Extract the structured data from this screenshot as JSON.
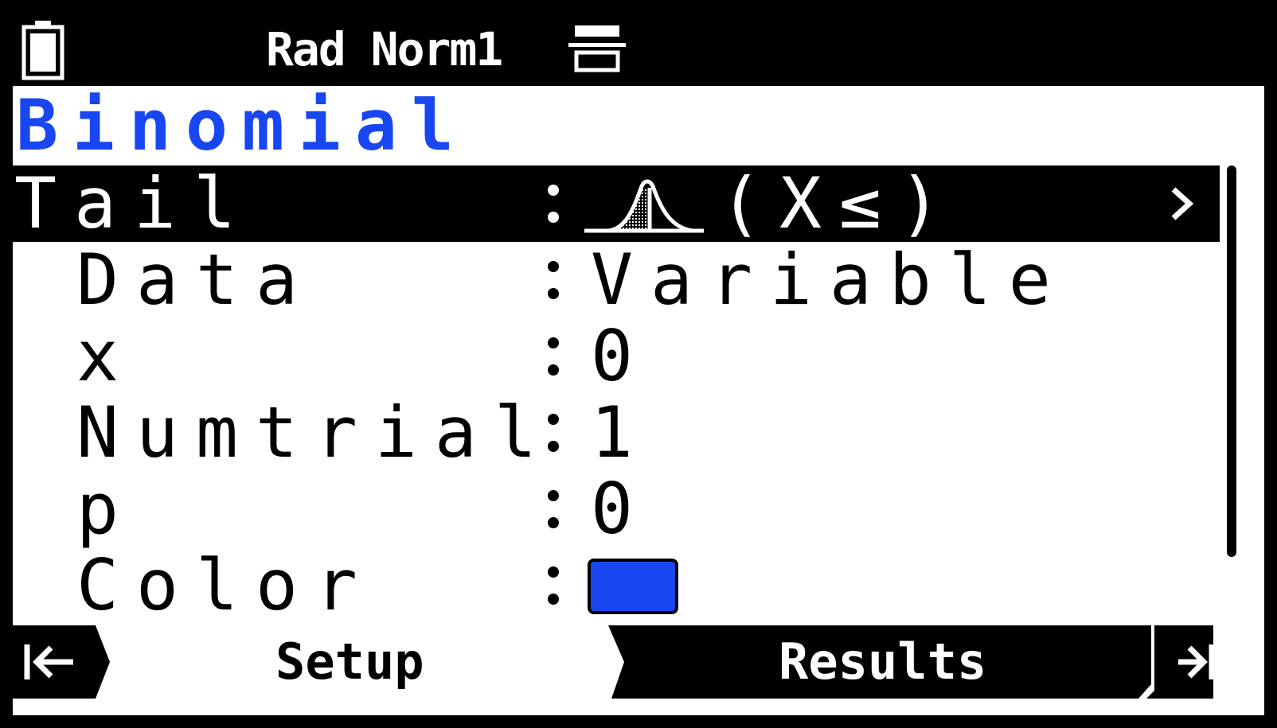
{
  "status_bar": {
    "mode": "Rad Norm1",
    "battery_icon": "battery-icon",
    "sheet_icon": "sheet-icon"
  },
  "app_title": "Binomial",
  "settings": [
    {
      "label": "Tail",
      "value": "(X≤)",
      "selected": true
    },
    {
      "label": "Data",
      "value": "Variable"
    },
    {
      "label": "x",
      "value": "0"
    },
    {
      "label": "Numtrial",
      "value": "1"
    },
    {
      "label": "p",
      "value": "0"
    },
    {
      "label": "Color",
      "value_color": "#1846f0"
    }
  ],
  "tabs": [
    {
      "label": "Setup",
      "active": true
    },
    {
      "label": "Results",
      "active": false
    }
  ],
  "colors": {
    "accent": "#1846f0",
    "background": "#ffffff",
    "ink": "#000000"
  }
}
